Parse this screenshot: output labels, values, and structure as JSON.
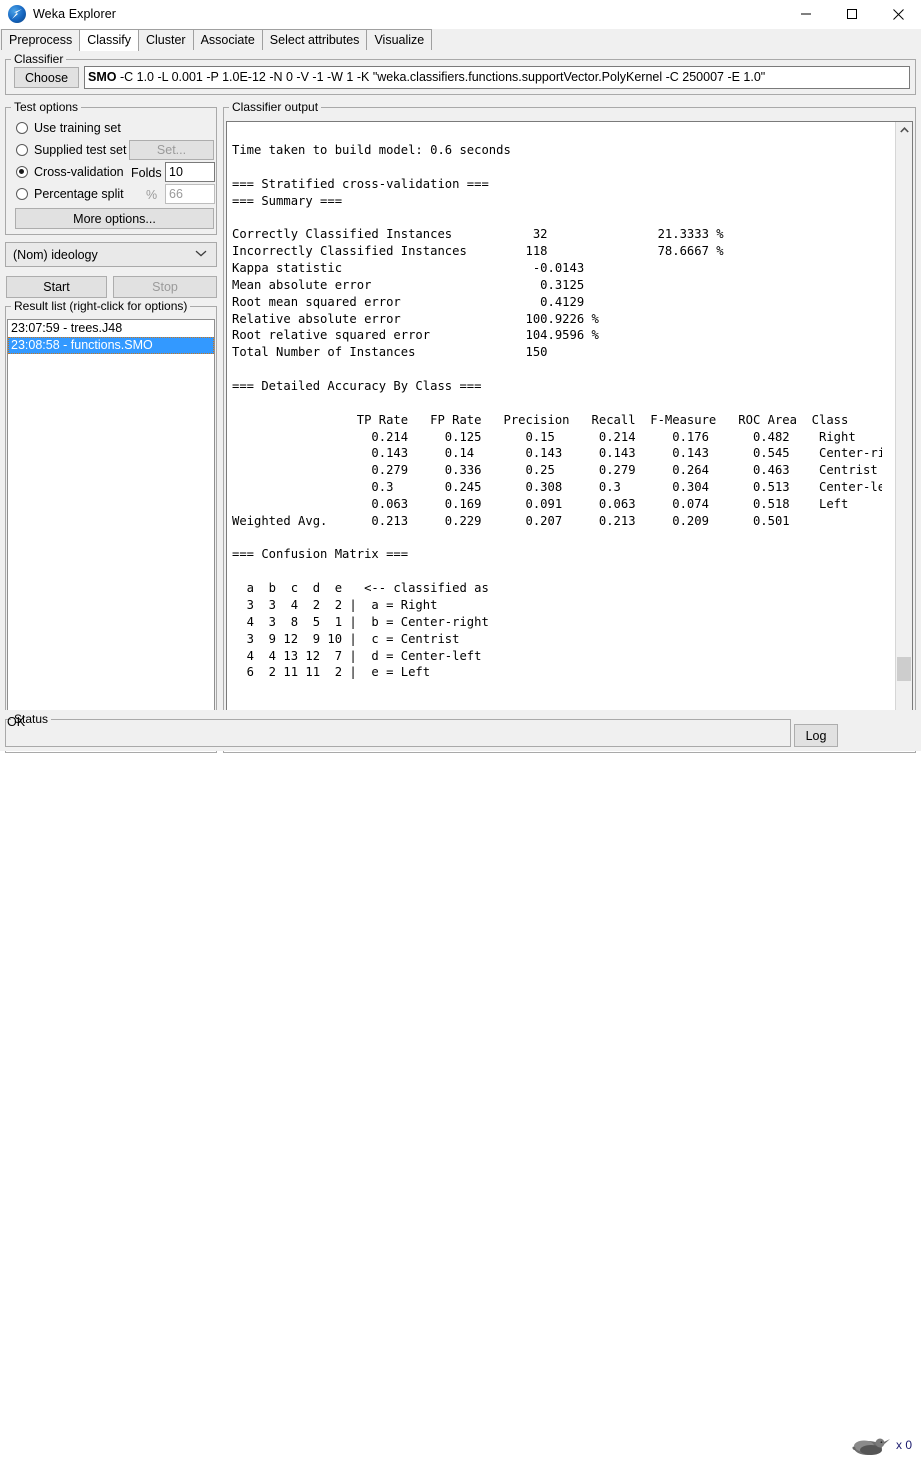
{
  "window": {
    "title": "Weka Explorer",
    "icon": "weka-bird-icon",
    "minimize_label": "–",
    "maximize_label": "□",
    "close_label": "✕"
  },
  "tabs": [
    {
      "label": "Preprocess",
      "active": false
    },
    {
      "label": "Classify",
      "active": true
    },
    {
      "label": "Cluster",
      "active": false
    },
    {
      "label": "Associate",
      "active": false
    },
    {
      "label": "Select attributes",
      "active": false
    },
    {
      "label": "Visualize",
      "active": false
    }
  ],
  "classifier": {
    "group_title": "Classifier",
    "choose_label": "Choose",
    "name": "SMO",
    "options": " -C 1.0 -L 0.001 -P 1.0E-12 -N 0 -V -1 -W 1 -K \"weka.classifiers.functions.supportVector.PolyKernel -C 250007 -E 1.0\""
  },
  "test_options": {
    "group_title": "Test options",
    "items": [
      {
        "label": "Use training set",
        "selected": false
      },
      {
        "label": "Supplied test set",
        "selected": false
      },
      {
        "label": "Cross-validation",
        "selected": true
      },
      {
        "label": "Percentage split",
        "selected": false
      }
    ],
    "set_button": "Set...",
    "folds_label": "Folds",
    "folds_value": "10",
    "percent_label": "%",
    "percent_value": "66",
    "more_options_button": "More options..."
  },
  "class_attribute": {
    "selected": "(Nom) ideology",
    "chevron": "chevron-down-icon"
  },
  "actions": {
    "start_label": "Start",
    "stop_label": "Stop"
  },
  "result_list": {
    "group_title": "Result list (right-click for options)",
    "items": [
      {
        "label": "23:07:59 - trees.J48",
        "selected": false
      },
      {
        "label": "23:08:58 - functions.SMO",
        "selected": true
      }
    ]
  },
  "output": {
    "group_title": "Classifier output",
    "text": "Time taken to build model: 0.6 seconds\n\n=== Stratified cross-validation ===\n=== Summary ===\n\nCorrectly Classified Instances           32               21.3333 %\nIncorrectly Classified Instances        118               78.6667 %\nKappa statistic                          -0.0143\nMean absolute error                       0.3125\nRoot mean squared error                   0.4129\nRelative absolute error                 100.9226 %\nRoot relative squared error             104.9596 %\nTotal Number of Instances               150     \n\n=== Detailed Accuracy By Class ===\n\n                 TP Rate   FP Rate   Precision   Recall  F-Measure   ROC Area  Class\n                   0.214     0.125      0.15      0.214     0.176      0.482    Right\n                   0.143     0.14       0.143     0.143     0.143      0.545    Center-right\n                   0.279     0.336      0.25      0.279     0.264      0.463    Centrist\n                   0.3       0.245      0.308     0.3       0.304      0.513    Center-left\n                   0.063     0.169      0.091     0.063     0.074      0.518    Left\nWeighted Avg.      0.213     0.229      0.207     0.213     0.209      0.501\n\n=== Confusion Matrix ===\n\n  a  b  c  d  e   <-- classified as\n  3  3  4  2  2 |  a = Right\n  4  3  8  5  1 |  b = Center-right\n  3  9 12  9 10 |  c = Centrist\n  4  4 13 12  7 |  d = Center-left\n  6  2 11 11  2 |  e = Left\n"
  },
  "scrollbars": {
    "vertical": {
      "up_arrow": "▲",
      "down_arrow": "▼"
    },
    "horizontal": {
      "left_arrow": "❮",
      "right_arrow": "❯"
    }
  },
  "status": {
    "group_title": "Status",
    "text": "OK",
    "log_button": "Log",
    "bird_icon": "weka-bird-icon",
    "bird_count": "x 0"
  },
  "colors": {
    "selection_blue": "#3399ff",
    "panel_gray": "#f0f0f0",
    "button_gray": "#e1e1e1",
    "accent_icon_blue": "#1565c0"
  }
}
